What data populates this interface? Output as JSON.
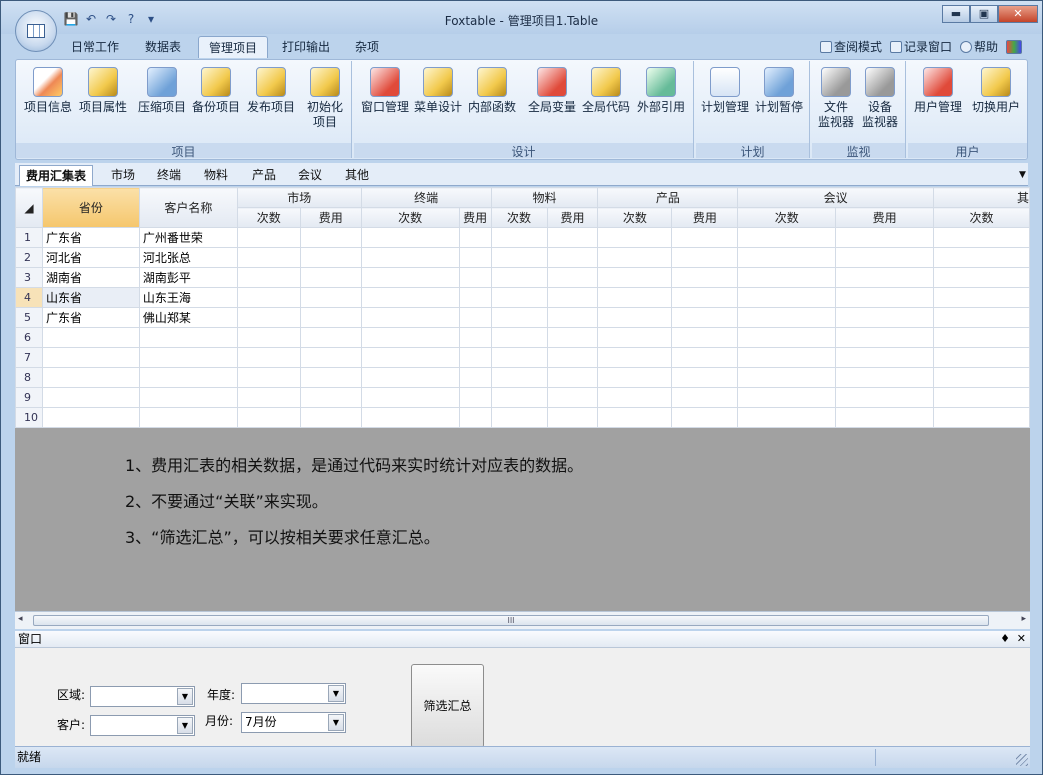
{
  "window": {
    "title": "Foxtable - 管理项目1.Table",
    "min": "▬",
    "max": "▣",
    "close": "✕"
  },
  "qat": [
    "💾",
    "↶",
    "↷",
    "?",
    "▾"
  ],
  "tabs": [
    {
      "label": "日常工作",
      "active": false
    },
    {
      "label": "数据表",
      "active": false
    },
    {
      "label": "管理项目",
      "active": true
    },
    {
      "label": "打印输出",
      "active": false
    },
    {
      "label": "杂项",
      "active": false
    }
  ],
  "right_links": [
    "查阅模式",
    "记录窗口",
    "帮助"
  ],
  "groups": [
    {
      "label": "项目",
      "items": [
        "项目信息",
        "项目属性",
        "压缩项目",
        "备份项目",
        "发布项目",
        "初始化\n项目"
      ]
    },
    {
      "label": "设计",
      "items": [
        "窗口管理",
        "菜单设计",
        "内部函数",
        "全局变量",
        "全局代码",
        "外部引用"
      ]
    },
    {
      "label": "计划",
      "items": [
        "计划管理",
        "计划暂停"
      ]
    },
    {
      "label": "监视",
      "items": [
        "文件\n监视器",
        "设备\n监视器"
      ]
    },
    {
      "label": "用户",
      "items": [
        "用户管理",
        "切换用户"
      ]
    }
  ],
  "sheet_tabs": [
    {
      "label": "费用汇集表",
      "active": true
    },
    {
      "label": "市场"
    },
    {
      "label": "终端"
    },
    {
      "label": "物料"
    },
    {
      "label": "产品"
    },
    {
      "label": "会议"
    },
    {
      "label": "其他"
    }
  ],
  "grid": {
    "col_province": "省份",
    "col_customer": "客户名称",
    "groups": [
      "市场",
      "终端",
      "物料",
      "产品",
      "会议",
      "其"
    ],
    "sub": {
      "count": "次数",
      "fee": "费用"
    },
    "rows": [
      {
        "n": "1",
        "province": "广东省",
        "customer": "广州番世荣"
      },
      {
        "n": "2",
        "province": "河北省",
        "customer": "河北张总"
      },
      {
        "n": "3",
        "province": "湖南省",
        "customer": "湖南彭平"
      },
      {
        "n": "4",
        "province": "山东省",
        "customer": "山东王海"
      },
      {
        "n": "5",
        "province": "广东省",
        "customer": "佛山郑某"
      },
      {
        "n": "6",
        "province": "",
        "customer": ""
      },
      {
        "n": "7",
        "province": "",
        "customer": ""
      },
      {
        "n": "8",
        "province": "",
        "customer": ""
      },
      {
        "n": "9",
        "province": "",
        "customer": ""
      },
      {
        "n": "10",
        "province": "",
        "customer": ""
      }
    ]
  },
  "notes": [
    "1、费用汇表的相关数据，是通过代码来实时统计对应表的数据。",
    "2、不要通过“关联”来实现。",
    "3、“筛选汇总”，可以按相关要求任意汇总。"
  ],
  "scroll": {
    "left": "◂",
    "right": "▸",
    "grip": "III"
  },
  "dock": {
    "title": "窗口",
    "pin": "♦",
    "close": "✕",
    "region_label": "区域:",
    "region_value": "",
    "customer_label": "客户:",
    "customer_value": "",
    "year_label": "年度:",
    "year_value": "",
    "month_label": "月份:",
    "month_value": "7月份",
    "button": "筛选汇总"
  },
  "status": "就绪"
}
